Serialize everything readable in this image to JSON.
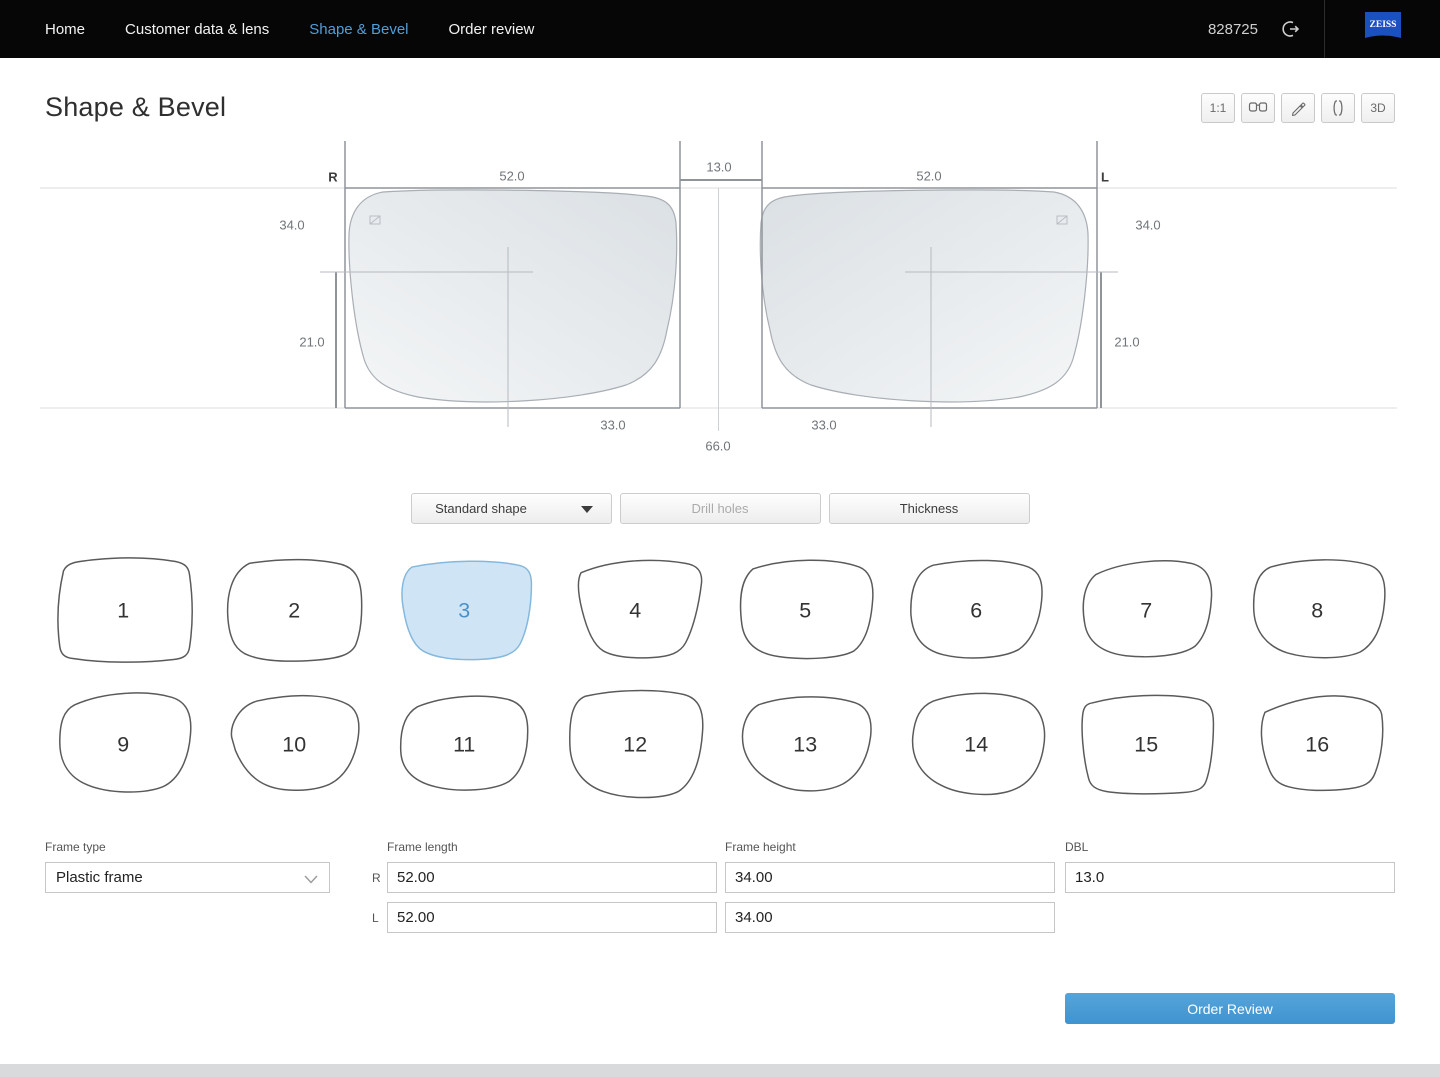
{
  "nav": {
    "items": [
      {
        "label": "Home",
        "active": false
      },
      {
        "label": "Customer data & lens",
        "active": false
      },
      {
        "label": "Shape & Bevel",
        "active": true
      },
      {
        "label": "Order review",
        "active": false
      }
    ],
    "order_number": "828725",
    "brand": "ZEISS"
  },
  "page": {
    "title": "Shape & Bevel"
  },
  "toolbar": {
    "scale_label": "1:1",
    "threeD_label": "3D"
  },
  "diagram": {
    "right_label": "R",
    "left_label": "L",
    "width_right": "52.0",
    "width_left": "52.0",
    "bridge": "13.0",
    "height_right": "34.0",
    "height_left": "34.0",
    "lower_right": "21.0",
    "lower_left": "21.0",
    "half_pd_right": "33.0",
    "half_pd_left": "33.0",
    "total_pd": "66.0"
  },
  "actions": {
    "shape_select_label": "Standard shape",
    "drill_holes_label": "Drill holes",
    "thickness_label": "Thickness"
  },
  "shapes": {
    "selected": 3,
    "items": [
      1,
      2,
      3,
      4,
      5,
      6,
      7,
      8,
      9,
      10,
      11,
      12,
      13,
      14,
      15,
      16
    ]
  },
  "form": {
    "frame_type_label": "Frame type",
    "frame_type_value": "Plastic frame",
    "frame_length_label": "Frame length",
    "frame_height_label": "Frame height",
    "dbl_label": "DBL",
    "right_tag": "R",
    "left_tag": "L",
    "frame_length_r": "52.00",
    "frame_length_l": "52.00",
    "frame_height_r": "34.00",
    "frame_height_l": "34.00",
    "dbl_value": "13.0"
  },
  "order_review": {
    "label": "Order Review"
  },
  "colors": {
    "nav_bg": "#060606",
    "nav_active": "#4f9fd9",
    "brand_blue": "#1b50c0",
    "selected_shape_fill": "#cfe5f6",
    "selected_shape_stroke": "#85b8dc",
    "primary_button": "#4398d2"
  }
}
